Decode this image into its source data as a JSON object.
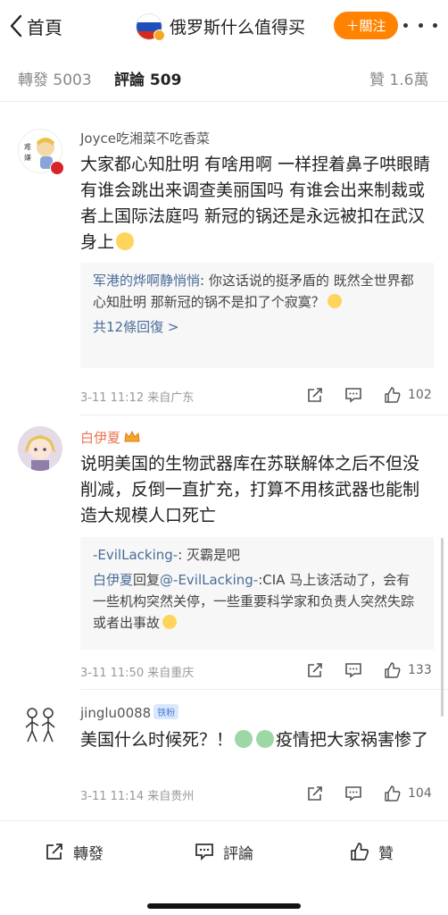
{
  "header": {
    "back_label": "首頁",
    "title": "俄罗斯什么值得买",
    "follow_label": "＋關注"
  },
  "tabs": [
    {
      "label": "轉發 5003",
      "active": false
    },
    {
      "label": "評論 509",
      "active": true
    },
    {
      "label": "贊 1.6萬",
      "active": false
    }
  ],
  "comments": [
    {
      "username": "Joyce吃湘菜不吃香菜",
      "text": "大家都心知肚明 有啥用啊 一样捏着鼻子哄眼睛 有谁会跳出来调查美丽国吗 有谁会出来制裁或者上国际法庭吗  新冠的锅还是永远被扣在武汉身上",
      "replies": [
        {
          "name": "军港的烨啊静悄悄",
          "text": ": 你这话说的挺矛盾的 既然全世界都心知肚明 那新冠的锅不是扣了个寂寞？"
        }
      ],
      "more_replies": "共12條回復 >",
      "time": "3-11 11:12",
      "location": "来自广东",
      "likes": "102"
    },
    {
      "username": "白伊夏",
      "text": "说明美国的生物武器库在苏联解体之后不但没削减，反倒一直扩充，打算不用核武器也能制造大规模人口死亡",
      "replies": [
        {
          "name": "-EvilLacking-",
          "text": ": 灭霸是吧"
        },
        {
          "name": "白伊夏",
          "connector": "回复",
          "name2": "@-EvilLacking-",
          "text": ":CIA 马上该活动了，会有一些机构突然关停，一些重要科学家和负责人突然失踪或者出事故"
        }
      ],
      "time": "3-11 11:50",
      "location": "来自重庆",
      "likes": "133"
    },
    {
      "username": "jinglu0088",
      "badge": "铁粉",
      "text_part1": "美国什么时候死？！",
      "text_part2": "疫情把大家祸害惨了",
      "time": "3-11 11:14",
      "location": "来自贵州",
      "likes": "104"
    }
  ],
  "bottom_bar": {
    "repost_label": "轉發",
    "comment_label": "評論",
    "like_label": "贊"
  },
  "colors": {
    "accent": "#ff8200",
    "link": "#4a6c99",
    "username_orange": "#eb7350"
  }
}
